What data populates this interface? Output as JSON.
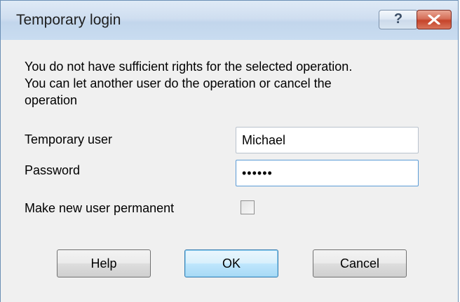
{
  "window": {
    "title": "Temporary login",
    "help_button_label": "?",
    "close_icon": "close-icon"
  },
  "message": {
    "lines": [
      "You do not have sufficient rights for the selected operation.",
      "You can let another user do the operation or cancel the",
      "operation"
    ]
  },
  "form": {
    "user_label": "Temporary user",
    "user_value": "Michael",
    "password_label": "Password",
    "password_value": "••••••",
    "permanent_label": "Make new user permanent",
    "permanent_checked": false
  },
  "buttons": {
    "help": "Help",
    "ok": "OK",
    "cancel": "Cancel"
  },
  "colors": {
    "dialog_background": "#f0f0f0",
    "titlebar": "#cfdef0",
    "close_button": "#c5442a",
    "default_button_border": "#3c7fb1",
    "focused_field_border": "#5b9bd5"
  }
}
